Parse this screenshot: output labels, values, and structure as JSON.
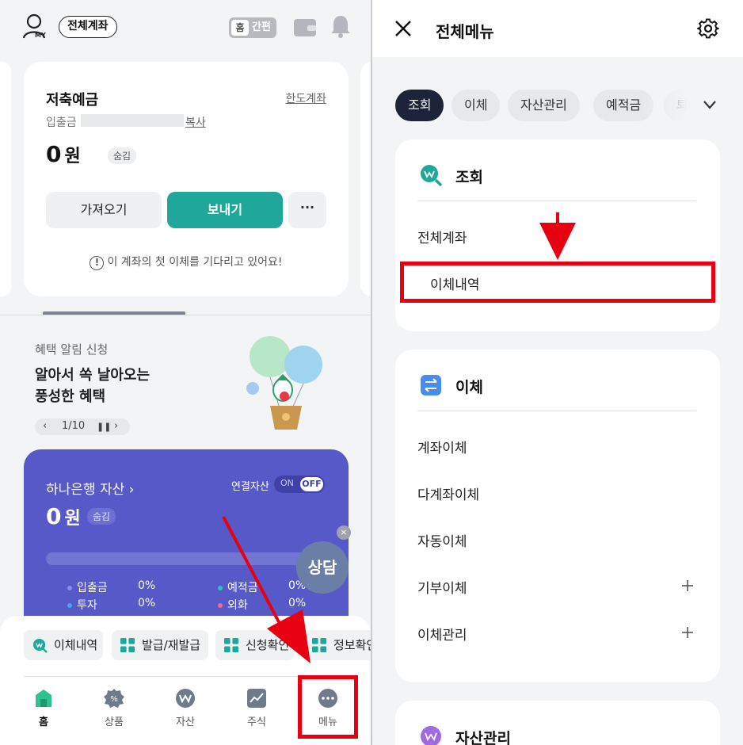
{
  "left": {
    "my_label": "MY",
    "account_pill": "전체계좌",
    "home_toggle": {
      "home": "홈",
      "simple": "간편"
    },
    "account_card": {
      "title": "저축예금",
      "limit_link": "한도계좌",
      "sub_label": "입출금",
      "copy_label": "복사",
      "balance": "0",
      "currency": "원",
      "hide_badge": "숨김",
      "btn_get": "가져오기",
      "btn_send": "보내기",
      "btn_more": "···",
      "notice": "이 계좌의 첫 이체를 기다리고 있어요!"
    },
    "promo": {
      "label": "혜택 알림 신청",
      "title_line1": "알아서 쏙 날아오는",
      "title_line2": "풍성한 혜택",
      "pager": "1/10"
    },
    "asset_card": {
      "title": "하나은행 자산 ›",
      "link_label": "연결자산",
      "on": "ON",
      "off": "OFF",
      "balance": "0",
      "currency": "원",
      "hide_badge": "숨김",
      "legend": [
        {
          "label": "입출금",
          "pct": "0%",
          "color": "#8a8cf0"
        },
        {
          "label": "예적금",
          "pct": "0%",
          "color": "#35c1b4"
        },
        {
          "label": "투자",
          "pct": "0%",
          "color": "#4aa3f0"
        },
        {
          "label": "외화",
          "pct": "0%",
          "color": "#ef6c8a"
        }
      ]
    },
    "consult": {
      "label": "상담",
      "close": "×"
    },
    "quick_chips": [
      {
        "label": "이체내역",
        "icon": "search-won-icon"
      },
      {
        "label": "발급/재발급",
        "icon": "grid-icon"
      },
      {
        "label": "신청확인",
        "icon": "grid-icon"
      },
      {
        "label": "정보확인",
        "icon": "grid-icon"
      }
    ],
    "tabs": [
      {
        "label": "홈",
        "icon": "home-icon"
      },
      {
        "label": "상품",
        "icon": "product-icon"
      },
      {
        "label": "자산",
        "icon": "asset-icon"
      },
      {
        "label": "주식",
        "icon": "stock-icon"
      },
      {
        "label": "메뉴",
        "icon": "menu-icon"
      }
    ]
  },
  "right": {
    "title": "전체메뉴",
    "categories": [
      {
        "label": "조회",
        "active": true
      },
      {
        "label": "이체",
        "active": false
      },
      {
        "label": "자산관리",
        "active": false
      },
      {
        "label": "예적금",
        "active": false
      },
      {
        "label": "퇴직",
        "active": false
      }
    ],
    "sections": [
      {
        "title": "조회",
        "icon": "search-won-icon",
        "color": "#1fa799",
        "items": [
          "전체계좌",
          "이체내역"
        ]
      },
      {
        "title": "이체",
        "icon": "transfer-icon",
        "color": "#4a8bf0",
        "items": [
          "계좌이체",
          "다계좌이체",
          "자동이체",
          "기부이체",
          "이체관리"
        ]
      },
      {
        "title": "자산관리",
        "icon": "asset-won-icon",
        "color": "#a06be0",
        "items": []
      }
    ]
  },
  "colors": {
    "accent_teal": "#1fa799",
    "asset_purple": "#5659c7",
    "highlight_red": "#e60012",
    "nav_dark": "#1d2439"
  }
}
